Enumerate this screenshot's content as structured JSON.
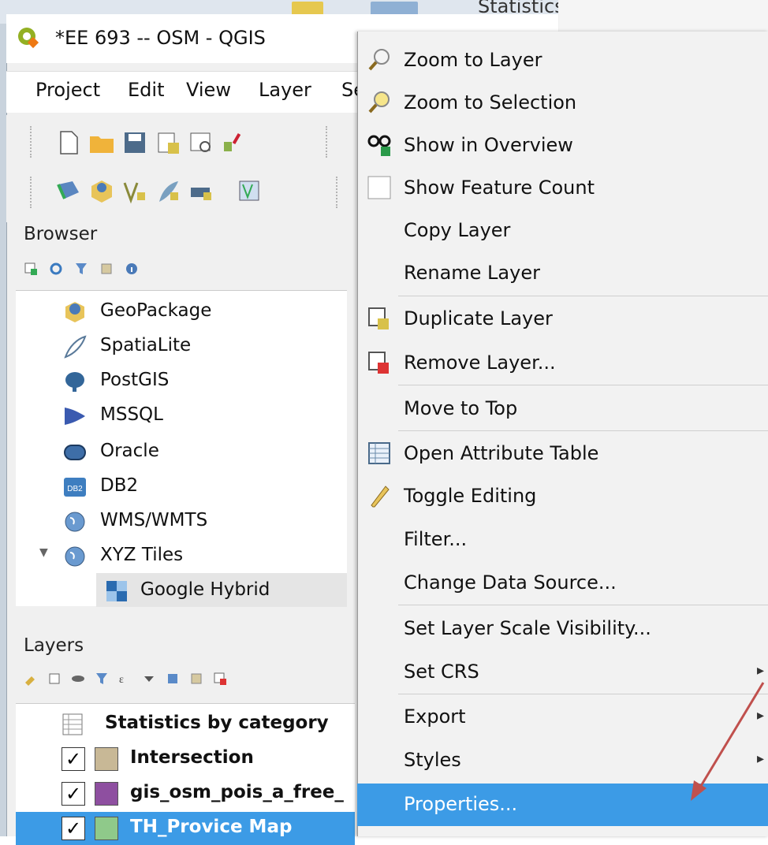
{
  "window": {
    "title": "*EE 693 -- OSM - QGIS"
  },
  "background_title": "Statistics by category :: Feat",
  "menubar": {
    "items": [
      "Project",
      "Edit",
      "View",
      "Layer",
      "Se"
    ]
  },
  "browser": {
    "header": "Browser",
    "items": [
      {
        "label": "GeoPackage",
        "icon": "geopackage-icon"
      },
      {
        "label": "SpatiaLite",
        "icon": "feather-icon"
      },
      {
        "label": "PostGIS",
        "icon": "elephant-icon"
      },
      {
        "label": "MSSQL",
        "icon": "mssql-icon"
      },
      {
        "label": "Oracle",
        "icon": "oracle-icon"
      },
      {
        "label": "DB2",
        "icon": "db2-icon"
      },
      {
        "label": "WMS/WMTS",
        "icon": "globe-icon"
      },
      {
        "label": "XYZ Tiles",
        "icon": "globe-icon"
      },
      {
        "label": "Google Hybrid",
        "icon": "tile-icon"
      }
    ]
  },
  "layers": {
    "header": "Layers",
    "items": [
      {
        "label": "Statistics by category",
        "checked": null,
        "color": null
      },
      {
        "label": "Intersection",
        "checked": true,
        "color": "#c8b896"
      },
      {
        "label": "gis_osm_pois_a_free_",
        "checked": true,
        "color": "#8e4fa0"
      },
      {
        "label": "TH_Provice Map",
        "checked": true,
        "color": "#8fc98a"
      }
    ]
  },
  "context_menu": {
    "items": [
      {
        "label": "Zoom to Layer",
        "icon": "zoom-icon"
      },
      {
        "label": "Zoom to Selection",
        "icon": "zoom-selection-icon"
      },
      {
        "label": "Show in Overview",
        "icon": "overview-glasses-icon"
      },
      {
        "label": "Show Feature Count",
        "icon": "checkbox-icon"
      },
      {
        "label": "Copy Layer",
        "icon": null
      },
      {
        "label": "Rename Layer",
        "icon": null
      },
      {
        "label": "Duplicate Layer",
        "icon": "duplicate-layer-icon"
      },
      {
        "label": "Remove Layer...",
        "icon": "remove-layer-icon"
      },
      {
        "label": "Move to Top",
        "icon": null
      },
      {
        "label": "Open Attribute Table",
        "icon": "attribute-table-icon"
      },
      {
        "label": "Toggle Editing",
        "icon": "pencil-icon"
      },
      {
        "label": "Filter...",
        "icon": null
      },
      {
        "label": "Change Data Source...",
        "icon": null
      },
      {
        "label": "Set Layer Scale Visibility...",
        "icon": null
      },
      {
        "label": "Set CRS",
        "icon": null
      },
      {
        "label": "Export",
        "icon": null
      },
      {
        "label": "Styles",
        "icon": null
      },
      {
        "label": "Properties...",
        "icon": null
      }
    ],
    "highlight_color": "#3c9be6"
  },
  "checkmark": "✓",
  "submenu_arrow": "▸"
}
